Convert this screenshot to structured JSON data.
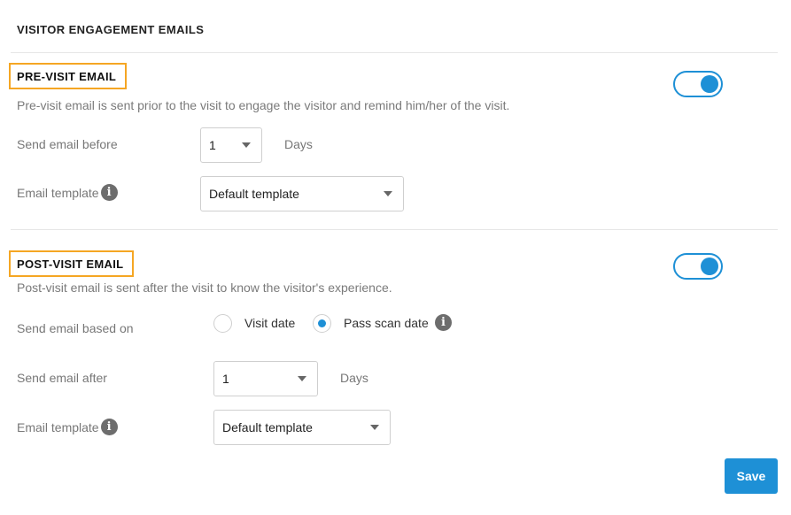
{
  "page": {
    "title": "VISITOR ENGAGEMENT EMAILS"
  },
  "pre_visit": {
    "title": "PRE-VISIT EMAIL",
    "description": "Pre-visit email is sent prior to the visit to engage the visitor and remind him/her of the visit.",
    "enabled": true,
    "send_before_label": "Send email before",
    "send_before_value": "1",
    "send_before_unit": "Days",
    "template_label": "Email template",
    "template_value": "Default template"
  },
  "post_visit": {
    "title": "POST-VISIT EMAIL",
    "description": "Post-visit email is sent after the visit to know the visitor's experience.",
    "enabled": true,
    "based_on_label": "Send email based on",
    "based_on_options": [
      "Visit date",
      "Pass scan date"
    ],
    "based_on_selected": "Pass scan date",
    "send_after_label": "Send email after",
    "send_after_value": "1",
    "send_after_unit": "Days",
    "template_label": "Email template",
    "template_value": "Default template"
  },
  "actions": {
    "save_label": "Save"
  },
  "icons": {
    "info": "info-icon",
    "dropdown": "caret-down-icon"
  },
  "colors": {
    "accent": "#1e90d6",
    "highlight_border": "#f5a623"
  }
}
